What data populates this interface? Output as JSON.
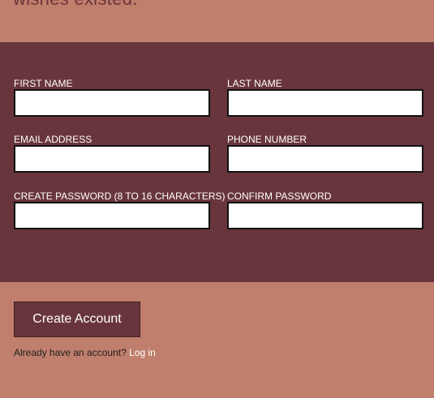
{
  "header": {
    "partial_text": "wishes existed."
  },
  "form": {
    "first_name_label": "FIRST NAME",
    "last_name_label": "LAST NAME",
    "email_label": "EMAIL ADDRESS",
    "phone_label": "PHONE NUMBER",
    "password_label": "CREATE PASSWORD (8 TO 16 CHARACTERS)",
    "confirm_password_label": "CONFIRM PASSWORD",
    "first_name_value": "",
    "last_name_value": "",
    "email_value": "",
    "phone_value": "",
    "password_value": "",
    "confirm_password_value": ""
  },
  "actions": {
    "create_account_label": "Create Account",
    "login_prompt": "Already have an account?",
    "login_link": "Log in"
  },
  "colors": {
    "band_background": "#c07f6c",
    "panel_background": "#69353c",
    "button_background": "#69353c",
    "link_color": "#ffffff"
  }
}
